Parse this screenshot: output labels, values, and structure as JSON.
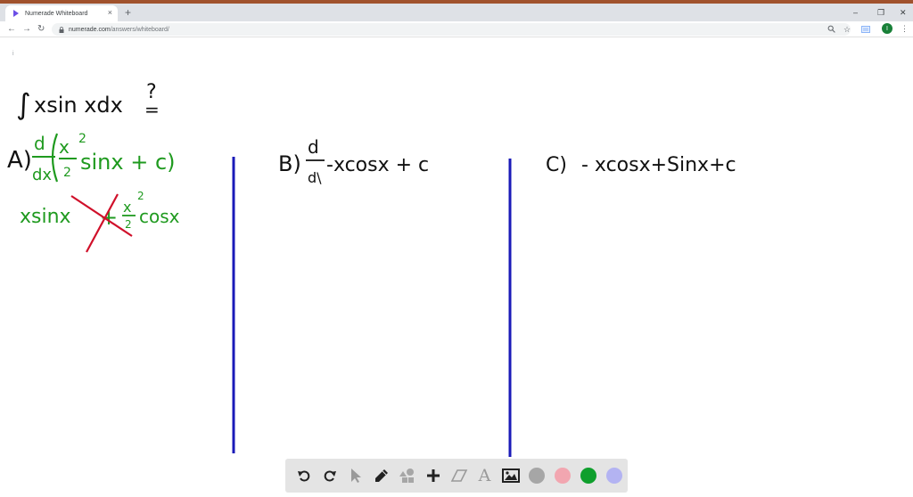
{
  "browser": {
    "tab_title": "Numerade Whiteboard",
    "tab_close": "×",
    "new_tab": "+",
    "url_domain": "numerade.com",
    "url_path": "/answers/whiteboard/",
    "avatar_letter": "I",
    "window_controls": {
      "minimize": "–",
      "restore": "❐",
      "close": "✕"
    }
  },
  "page": {
    "info_glyph": "i"
  },
  "whiteboard": {
    "ink_colors": {
      "black": "#111111",
      "green": "#1f9a1f",
      "red": "#d0102a",
      "blue": "#1a1ab8"
    },
    "question": {
      "integral": "∫",
      "expr": "xsin xdx",
      "mark": "?",
      "eq": "="
    },
    "option_a": {
      "label": "A)",
      "d": "d",
      "dx": "dx",
      "x": "x",
      "sq": "2",
      "two": "2",
      "rest": "sinx + c)"
    },
    "option_a_work": {
      "first": "xsinx",
      "plus": "+",
      "x": "x",
      "sq": "2",
      "two": "2",
      "cos": "cosx"
    },
    "option_b": {
      "label": "B)",
      "d": "d",
      "dx": "d\\",
      "rest": "-xcosx + c"
    },
    "option_c": {
      "label": "C)",
      "expr": "- xcosx+Sinx+c"
    }
  },
  "tools": [
    {
      "name": "undo-icon"
    },
    {
      "name": "redo-icon"
    },
    {
      "name": "pointer-icon"
    },
    {
      "name": "pen-icon"
    },
    {
      "name": "shapes-icon"
    },
    {
      "name": "add-icon"
    },
    {
      "name": "eraser-icon"
    },
    {
      "name": "text-icon"
    },
    {
      "name": "image-icon"
    }
  ],
  "swatches": [
    {
      "name": "color-swatch-gray",
      "color": "#a6a6a6"
    },
    {
      "name": "color-swatch-pink",
      "color": "#f2a6b0"
    },
    {
      "name": "color-swatch-green",
      "color": "#0f9f2d"
    },
    {
      "name": "color-swatch-lavender",
      "color": "#b3b3f2"
    }
  ],
  "text_tool_glyph": "A"
}
